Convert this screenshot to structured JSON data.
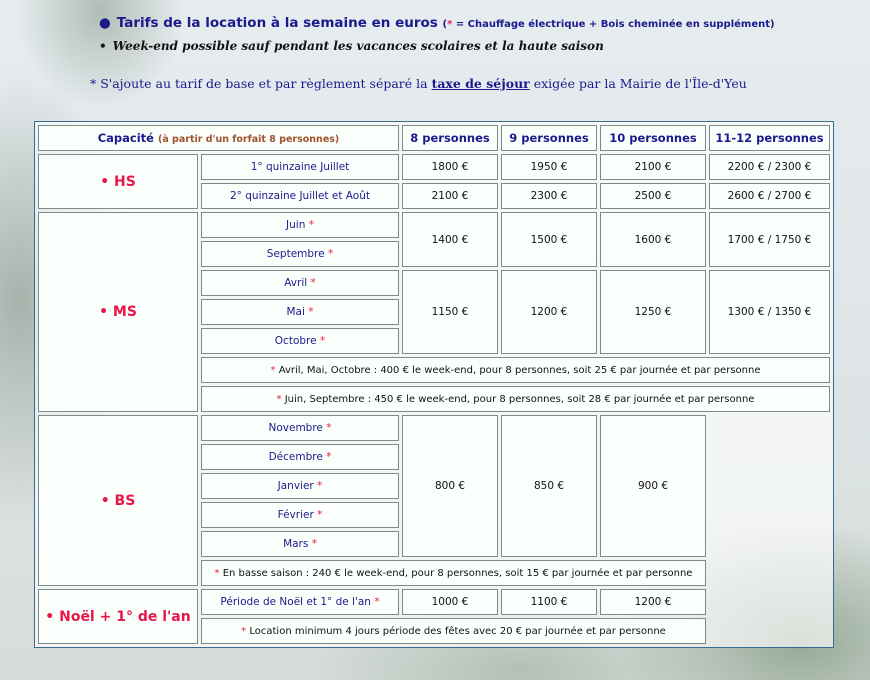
{
  "intro": {
    "line1": "Tarifs de la location à la semaine en euros",
    "line1_note_open": "(",
    "line1_note_star": "*",
    "line1_note_text": " = Chauffage électrique + Bois cheminée en supplément)",
    "line2": "Week-end possible sauf pendant les vacances scolaires et la haute saison",
    "line3_before": "* S'ajoute au tarif de base et par règlement séparé la ",
    "line3_link": "taxe de séjour",
    "line3_after": " exigée par la Mairie de l'Île-d'Yeu"
  },
  "table": {
    "header": {
      "capacity": "Capacité",
      "capacity_note": "(à partir d'un forfait 8 personnes)",
      "cols": [
        "8 personnes",
        "9 personnes",
        "10 personnes",
        "11-12 personnes"
      ]
    },
    "hs": {
      "label": "• HS",
      "rows": [
        {
          "period": "1° quinzaine Juillet",
          "prices": [
            "1800 €",
            "1950 €",
            "2100 €",
            "2200 € / 2300 €"
          ]
        },
        {
          "period": "2° quinzaine Juillet et Août",
          "prices": [
            "2100 €",
            "2300 €",
            "2500 €",
            "2600 € / 2700 €"
          ]
        }
      ]
    },
    "ms": {
      "label": "• MS",
      "group1": {
        "periods": [
          "Juin",
          "Septembre"
        ],
        "prices": [
          "1400 €",
          "1500 €",
          "1600 €",
          "1700 € / 1750 €"
        ]
      },
      "group2": {
        "periods": [
          "Avril",
          "Mai",
          "Octobre"
        ],
        "prices": [
          "1150 €",
          "1200 €",
          "1250 €",
          "1300 € / 1350 €"
        ]
      },
      "notes": [
        "Avril, Mai, Octobre : 400 € le week-end, pour 8 personnes, soit 25 € par journée et par personne",
        "Juin, Septembre : 450 € le week-end, pour 8 personnes, soit 28 € par journée et par personne"
      ]
    },
    "bs": {
      "label": "• BS",
      "periods": [
        "Novembre",
        "Décembre",
        "Janvier",
        "Février",
        "Mars"
      ],
      "prices": [
        "800 €",
        "850 €",
        "900 €"
      ],
      "note": "En basse saison : 240 € le week-end, pour 8 personnes, soit 15 € par journée et par personne"
    },
    "noel": {
      "label": "• Noël + 1° de l'an",
      "period": "Période de Noël et 1° de l'an",
      "prices": [
        "1000 €",
        "1100 €",
        "1200 €"
      ],
      "note": "Location minimum 4 jours période des fêtes avec 20 € par journée et par personne"
    },
    "star": "*"
  },
  "colors": {
    "title_blue": "#1a1a8c",
    "accent_red": "#e8174a",
    "header_bg": "#dff6ff",
    "note_brown": "#a0522d"
  }
}
